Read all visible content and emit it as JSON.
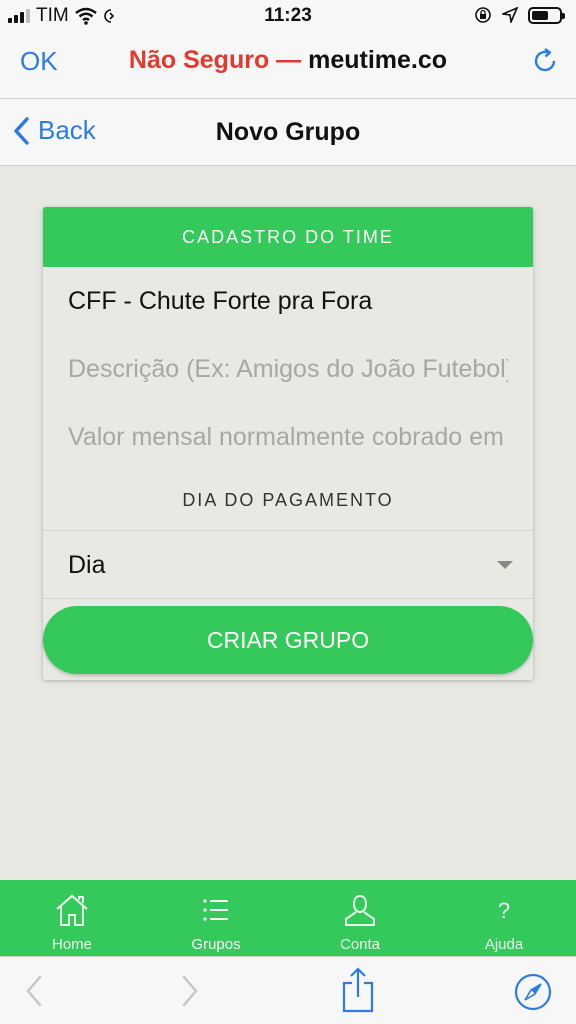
{
  "status_bar": {
    "carrier": "TIM",
    "time": "11:23"
  },
  "browser": {
    "ok_label": "OK",
    "security_warning": "Não Seguro —",
    "domain": "meutime.co"
  },
  "nav": {
    "back_label": "Back",
    "title": "Novo Grupo"
  },
  "form": {
    "header": "CADASTRO DO TIME",
    "team_name_value": "CFF - Chute Forte pra Fora",
    "description_placeholder": "Descrição (Ex: Amigos do João Futebol)",
    "monthly_fee_placeholder": "Valor mensal normalmente cobrado em R$",
    "payment_section_label": "DIA DO PAGAMENTO",
    "day_select_value": "Dia",
    "submit_label": "CRIAR GRUPO"
  },
  "tabs": [
    {
      "label": "Home",
      "icon": "home-icon"
    },
    {
      "label": "Grupos",
      "icon": "list-icon"
    },
    {
      "label": "Conta",
      "icon": "user-icon"
    },
    {
      "label": "Ajuda",
      "icon": "help-icon"
    }
  ],
  "colors": {
    "accent_green": "#34c95a",
    "link_blue": "#2d7ce4",
    "warning_red": "#e23a2e",
    "background": "#e8e8e3"
  }
}
